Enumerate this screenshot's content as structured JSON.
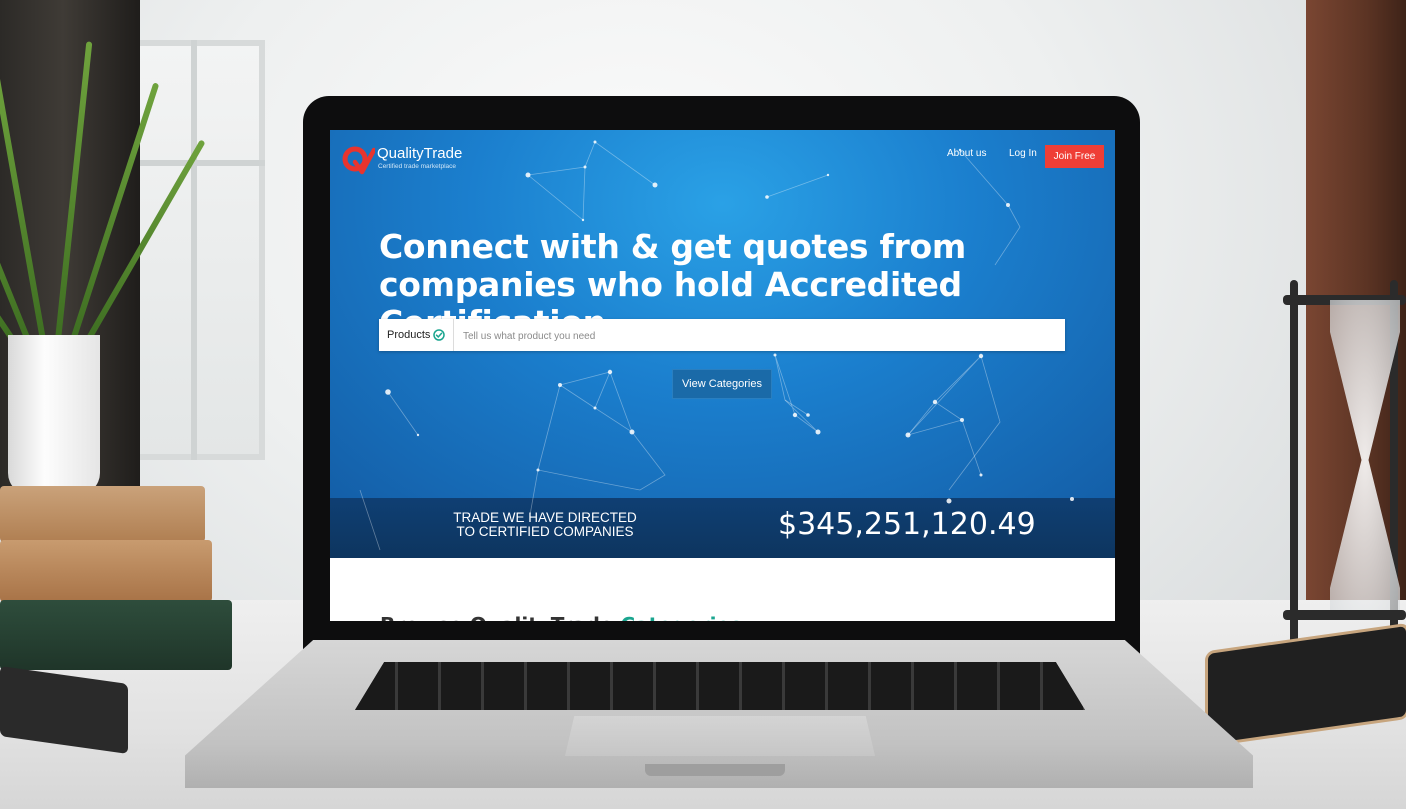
{
  "colors": {
    "hero_blue": "#1b7fce",
    "stats_bar": "#0f3f73",
    "join_red": "#ef3e36",
    "accent_teal": "#1aa58f",
    "check_teal": "#1aa58f"
  },
  "header": {
    "brand_name": "QualityTrade",
    "brand_tagline": "Certified trade marketplace",
    "logo_icon": "qualitytrade-q-logo",
    "nav": {
      "about": "About us",
      "login": "Log In",
      "join": "Join Free"
    }
  },
  "hero": {
    "headline": "Connect with & get quotes from companies who hold Accredited Certification",
    "search": {
      "type_label": "Products",
      "type_icon": "check-circle-icon",
      "placeholder": "Tell us what product you need"
    },
    "view_categories": "View Categories"
  },
  "stats": {
    "label_line1": "TRADE WE HAVE DIRECTED",
    "label_line2": "TO CERTIFIED COMPANIES",
    "value": "$345,251,120.49"
  },
  "browse": {
    "prefix": "Browse QualityTrade ",
    "accent": "Categories"
  }
}
